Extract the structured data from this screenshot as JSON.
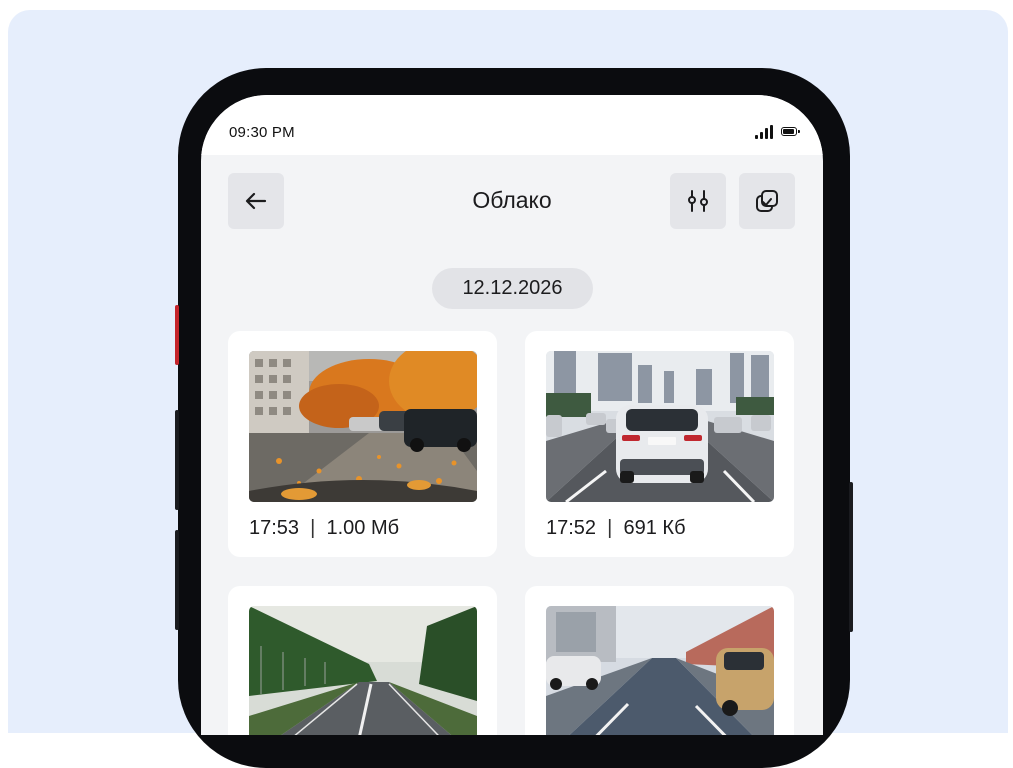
{
  "status_bar": {
    "time": "09:30 PM"
  },
  "header": {
    "title": "Облако"
  },
  "date_group": "12.12.2026",
  "videos": [
    {
      "time": "17:53",
      "size": "1.00 Мб",
      "scene": "autumn-parking"
    },
    {
      "time": "17:52",
      "size": "691 Кб",
      "scene": "city-traffic"
    },
    {
      "time": "",
      "size": "",
      "scene": "forest-highway"
    },
    {
      "time": "",
      "size": "",
      "scene": "city-street"
    }
  ],
  "colors": {
    "backdrop": "#e6eefc",
    "phone_frame": "#0b0c0f",
    "screen_bg": "#f3f4f6",
    "button_bg": "#e4e5e9",
    "card_bg": "#ffffff"
  },
  "icons": [
    "back-arrow-icon",
    "filter-sliders-icon",
    "select-copy-icon",
    "signal-icon",
    "battery-icon"
  ]
}
